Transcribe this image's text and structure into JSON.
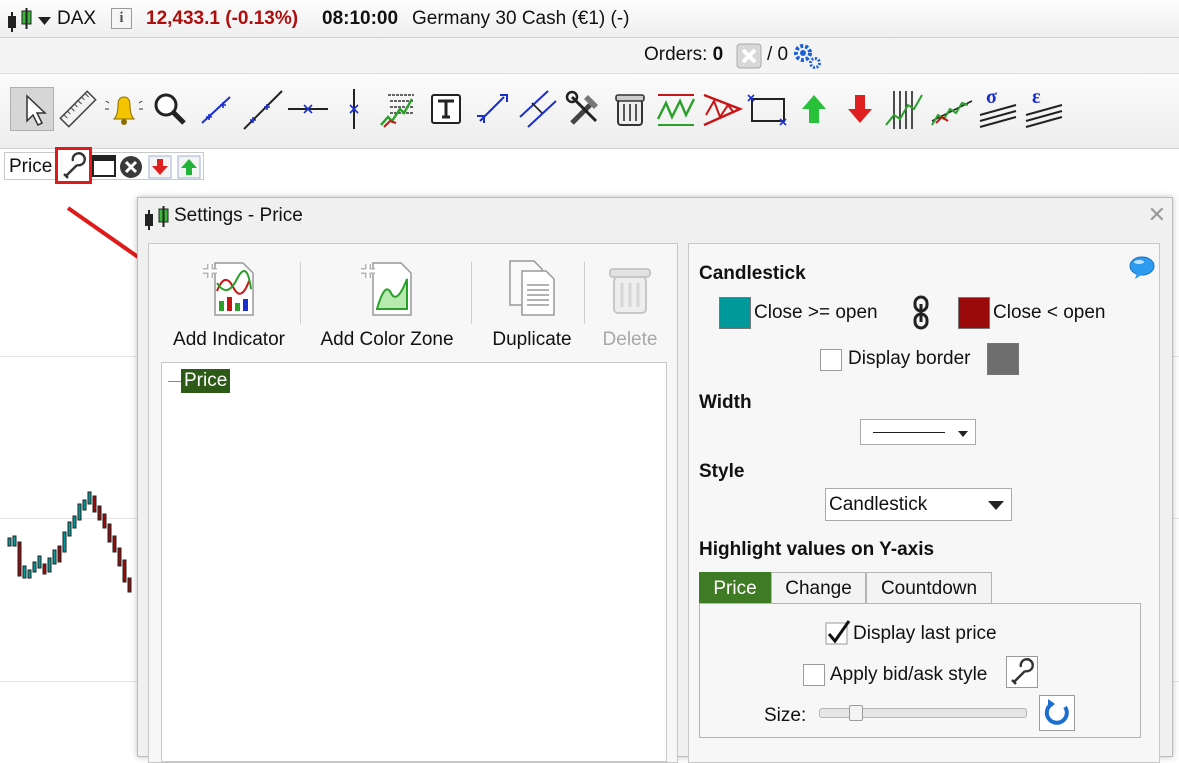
{
  "quote": {
    "symbol": "DAX",
    "info_icon": "i",
    "price": "12,433.1 (-0.13%)",
    "time": "08:10:00",
    "name": "Germany 30 Cash (€1) (-)",
    "price_color": "#b00d0d"
  },
  "orders": {
    "label": "Orders:",
    "count": "0",
    "slash_label": "/ 0"
  },
  "toolbar": {
    "tools": [
      "pointer-icon",
      "ruler-icon",
      "alert-bell-icon",
      "zoom-icon",
      "trendline-icon",
      "ray-icon",
      "horizontal-line-icon",
      "vertical-line-icon",
      "fibonacci-icon",
      "text-icon",
      "extend-line-icon",
      "parallel-channel-icon",
      "tools-icon",
      "trash-icon",
      "zigzag-icon",
      "triangle-icon",
      "rectangle-icon",
      "buy-arrow-icon",
      "sell-arrow-icon",
      "vertical-lines-icon",
      "regression-icon",
      "sigma-icon",
      "epsilon-icon"
    ],
    "sigma": "σ",
    "epsilon": "ε"
  },
  "pricebar": {
    "label": "Price"
  },
  "dialog": {
    "title": "Settings - Price",
    "close": "✕",
    "actions": {
      "add_indicator": "Add Indicator",
      "add_color_zone": "Add Color Zone",
      "duplicate": "Duplicate",
      "delete": "Delete"
    },
    "tree": {
      "root": "Price"
    },
    "candlestick": {
      "heading": "Candlestick",
      "up_label": "Close >= open",
      "down_label": "Close < open",
      "up_color": "#00999b",
      "down_color": "#9a0a0a",
      "display_border": "Display border",
      "border_color": "#6e6e6e"
    },
    "width": {
      "heading": "Width"
    },
    "style": {
      "heading": "Style",
      "value": "Candlestick"
    },
    "highlight": {
      "heading": "Highlight values on Y-axis",
      "tabs": [
        "Price",
        "Change",
        "Countdown"
      ],
      "display_last_price": "Display last price",
      "apply_bid_ask": "Apply bid/ask style",
      "size_label": "Size:",
      "size_level": 0.15
    },
    "accent_color": "#3f7a25"
  }
}
